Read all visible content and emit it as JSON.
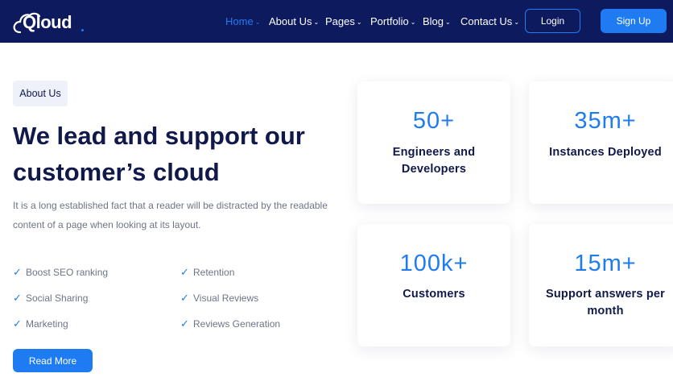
{
  "header": {
    "logo_text": "Qloud",
    "nav": [
      {
        "label": "Home",
        "active": true
      },
      {
        "label": "About Us",
        "active": false
      },
      {
        "label": "Pages",
        "active": false
      },
      {
        "label": "Portfolio",
        "active": false
      },
      {
        "label": "Blog",
        "active": false
      },
      {
        "label": "Contact Us",
        "active": false
      }
    ],
    "nav_chevron": "⌄",
    "login_label": "Login",
    "signup_label": "Sign Up"
  },
  "about": {
    "badge": "About Us",
    "title_line1": "We lead and support our",
    "title_line2": "customer’s cloud",
    "description_line1": "It is a long established fact that a reader will be distracted by the readable",
    "description_line2": "content of a page when looking at its layout.",
    "check_icon": "✓",
    "features": [
      "Boost SEO ranking",
      "Retention",
      "Social Sharing",
      "Visual Reviews",
      "Marketing",
      "Reviews Generation"
    ],
    "read_more_label": "Read More"
  },
  "stats": [
    {
      "value": "50+",
      "label_line1": "Engineers and",
      "label_line2": "Developers"
    },
    {
      "value": "35m+",
      "label_line1": "Instances Deployed",
      "label_line2": ""
    },
    {
      "value": "100k+",
      "label_line1": "Customers",
      "label_line2": ""
    },
    {
      "value": "15m+",
      "label_line1": "Support answers per",
      "label_line2": "month"
    }
  ],
  "colors": {
    "header_bg": "#0d1a5e",
    "accent": "#1f7bf2",
    "heading": "#10194a",
    "body_text": "#6f7486",
    "badge_bg": "#eef1f8"
  },
  "icons": {
    "logo": "cloud-icon",
    "feature_bullet": "check-icon",
    "nav_dropdown": "chevron-down-icon"
  }
}
